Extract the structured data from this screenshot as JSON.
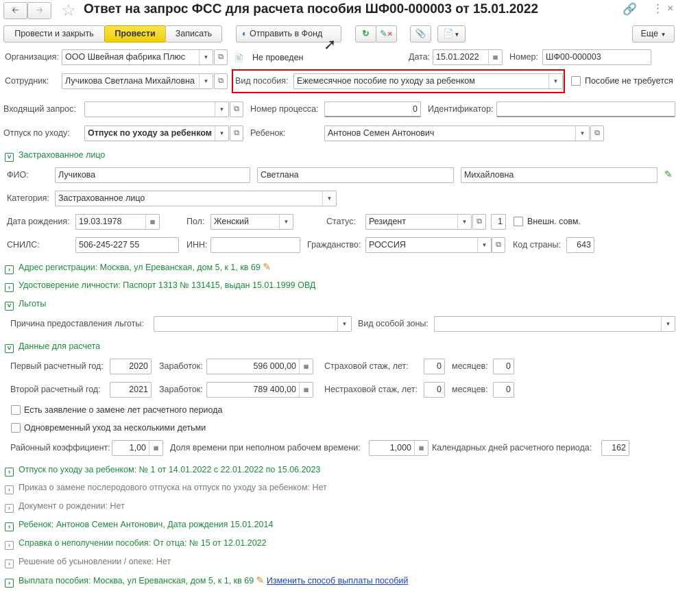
{
  "window": {
    "title": "Ответ на запрос ФСС для расчета пособия ШФ00-000003 от 15.01.2022"
  },
  "toolbar": {
    "post_close": "Провести и закрыть",
    "post": "Провести",
    "save": "Записать",
    "send": "Отправить в Фонд",
    "more": "Еще"
  },
  "header": {
    "org_label": "Организация:",
    "org_value": "ООО Швейная фабрика Плюс",
    "status": "Не проведен",
    "date_label": "Дата:",
    "date_value": "15.01.2022",
    "num_label": "Номер:",
    "num_value": "ШФ00-000003",
    "emp_label": "Сотрудник:",
    "emp_value": "Лучикова Светлана Михайловна",
    "benefit_label": "Вид пособия:",
    "benefit_value": "Ежемесячное пособие по уходу за ребенком",
    "not_required_label": "Пособие не требуется",
    "incoming_label": "Входящий запрос:",
    "incoming_value": "",
    "proc_label": "Номер процесса:",
    "proc_value": "0",
    "ident_label": "Идентификатор:",
    "ident_value": "",
    "leave_label": "Отпуск по уходу:",
    "leave_value": "Отпуск по уходу за ребенком",
    "child_label": "Ребенок:",
    "child_value": "Антонов Семен Антонович"
  },
  "insured": {
    "section": "Застрахованное лицо",
    "fio_label": "ФИО:",
    "last": "Лучикова",
    "first": "Светлана",
    "middle": "Михайловна",
    "cat_label": "Категория:",
    "cat_value": "Застрахованное лицо",
    "dob_label": "Дата рождения:",
    "dob_value": "19.03.1978",
    "sex_label": "Пол:",
    "sex_value": "Женский",
    "status_label": "Статус:",
    "status_value": "Резидент",
    "status_code": "1",
    "ext_label": "Внешн. совм.",
    "snils_label": "СНИЛС:",
    "snils_value": "506-245-227 55",
    "inn_label": "ИНН:",
    "inn_value": "",
    "cit_label": "Гражданство:",
    "cit_value": "РОССИЯ",
    "country_label": "Код страны:",
    "country_value": "643"
  },
  "sections": {
    "address": "Адрес регистрации: Москва, ул Ереванская, дом 5, к 1, кв 69",
    "identity": "Удостоверение личности: Паспорт 1313 № 131415, выдан 15.01.1999 ОВД",
    "benefits": "Льготы",
    "calc": "Данные для расчета",
    "leave": "Отпуск по уходу за ребенком: № 1 от 14.01.2022 с 22.01.2022 по 15.06.2023",
    "order": "Приказ о замене послеродового отпуска на отпуск по уходу за ребенком: Нет",
    "birth": "Документ о рождении: Нет",
    "child": "Ребенок: Антонов Семен Антонович, Дата рождения 15.01.2014",
    "cert": "Справка о неполучении пособия: От отца: № 15 от 12.01.2022",
    "adoption": "Решение об усыновлении / опеке: Нет",
    "payment": "Выплата пособия: Москва, ул Ереванская, дом 5, к 1, кв 69",
    "change_payment": "Изменить способ выплаты пособий"
  },
  "benefits": {
    "reason_label": "Причина предоставления льготы:",
    "reason_value": "",
    "zone_label": "Вид особой зоны:",
    "zone_value": ""
  },
  "calc": {
    "year1_label": "Первый расчетный год:",
    "year1": "2020",
    "earn1_label": "Заработок:",
    "earn1": "596 000,00",
    "ins1_label": "Страховой стаж, лет:",
    "ins1_years": "0",
    "months1_label": "месяцев:",
    "ins1_months": "0",
    "year2_label": "Второй расчетный год:",
    "year2": "2021",
    "earn2_label": "Заработок:",
    "earn2": "789 400,00",
    "ins2_label": "Нестраховой стаж, лет:",
    "ins2_years": "0",
    "months2_label": "месяцев:",
    "ins2_months": "0",
    "replace_label": "Есть заявление о замене лет расчетного периода",
    "multi_label": "Одновременный уход за несколькими детьми",
    "coef_label": "Районный коэффициент:",
    "coef": "1,00",
    "part_label": "Доля времени при неполном рабочем времени:",
    "part": "1,000",
    "days_label": "Календарных дней расчетного периода:",
    "days": "162"
  },
  "colors": {
    "accent_green": "#1c8a3a",
    "post_yellow": "#f5d816",
    "highlight_red": "#e00000",
    "link": "#1a44c0"
  }
}
